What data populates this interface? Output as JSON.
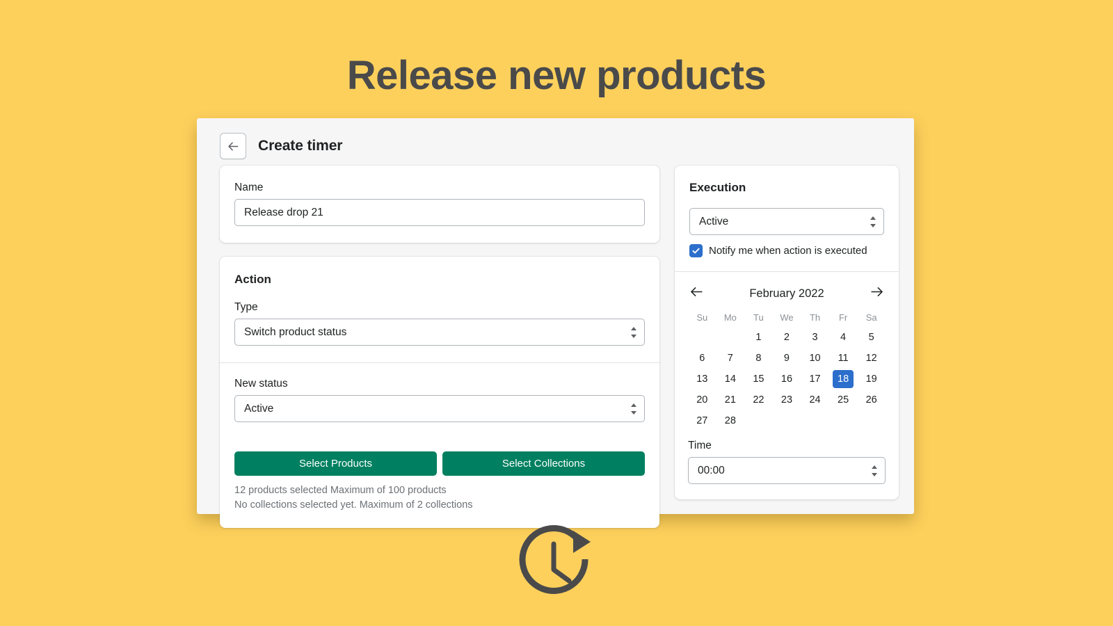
{
  "page": {
    "hero_title": "Release new products",
    "background_color": "#FDD05C",
    "accent_green": "#008060",
    "accent_blue": "#2C6ECB"
  },
  "window": {
    "title": "Create timer",
    "back_icon": "arrow-left-icon"
  },
  "name_card": {
    "label": "Name",
    "value": "Release drop 21"
  },
  "action_card": {
    "title": "Action",
    "type": {
      "label": "Type",
      "value": "Switch product status"
    },
    "new_status": {
      "label": "New status",
      "value": "Active"
    },
    "buttons": {
      "select_products": "Select Products",
      "select_collections": "Select Collections"
    },
    "helper_products": "12 products selected Maximum of 100 products",
    "helper_collections": "No collections selected yet. Maximum of 2 collections"
  },
  "execution_card": {
    "title": "Execution",
    "status_value": "Active",
    "notify_label": "Notify me when action is executed",
    "notify_checked": true
  },
  "calendar": {
    "month_label": "February 2022",
    "prev_icon": "arrow-left-icon",
    "next_icon": "arrow-right-icon",
    "weekdays": [
      "Su",
      "Mo",
      "Tu",
      "We",
      "Th",
      "Fr",
      "Sa"
    ],
    "selected_day": 18,
    "weeks": [
      [
        "",
        "",
        "1",
        "2",
        "3",
        "4",
        "5"
      ],
      [
        "6",
        "7",
        "8",
        "9",
        "10",
        "11",
        "12"
      ],
      [
        "13",
        "14",
        "15",
        "16",
        "17",
        "18",
        "19"
      ],
      [
        "20",
        "21",
        "22",
        "23",
        "24",
        "25",
        "26"
      ],
      [
        "27",
        "28",
        "",
        "",
        "",
        "",
        ""
      ]
    ]
  },
  "time_card": {
    "label": "Time",
    "value": "00:00"
  },
  "footer": {
    "icon": "clock-arrow-icon"
  }
}
